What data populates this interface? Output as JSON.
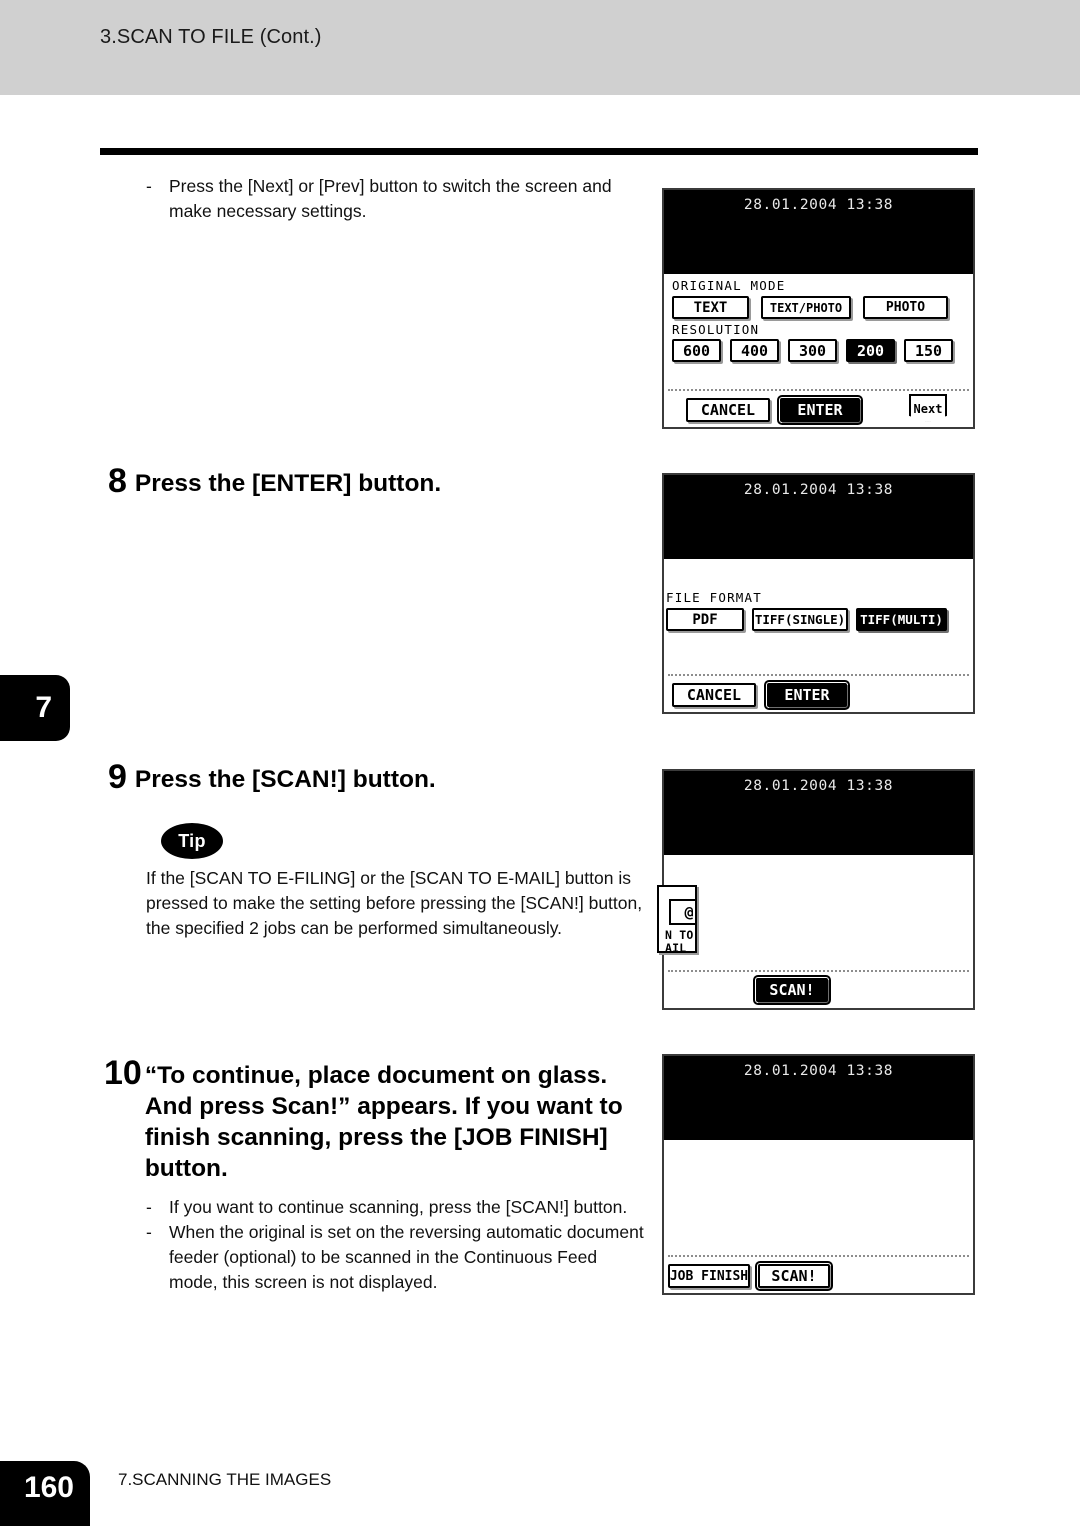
{
  "header": {
    "title": "3.SCAN TO FILE (Cont.)"
  },
  "chapter_tab": {
    "number": "7"
  },
  "footer": {
    "page_number": "160",
    "section": "7.SCANNING THE IMAGES"
  },
  "intro_note": {
    "dash": "-",
    "text": "Press the [Next] or [Prev] button to switch the screen and make necessary settings."
  },
  "steps": [
    {
      "number": "8",
      "title": "Press the [ENTER] button."
    },
    {
      "number": "9",
      "title": "Press the [SCAN!] button."
    },
    {
      "number": "10",
      "title": "“To continue, place document on glass. And press Scan!” appears. If you want to finish scanning, press the [JOB FINISH] button."
    }
  ],
  "tip": {
    "badge": "Tip",
    "text": "If the [SCAN TO E-FILING] or the [SCAN TO E-MAIL] button is pressed to make the setting before pressing the [SCAN!] button, the specified 2 jobs can be performed simultaneously."
  },
  "step10_notes": [
    {
      "dash": "-",
      "text": "If you want to continue scanning, press the [SCAN!] button."
    },
    {
      "dash": "-",
      "text": "When the original is set on the reversing automatic document feeder (optional) to be scanned in the Continuous Feed mode, this screen is not displayed."
    }
  ],
  "screens": [
    {
      "id": "original-mode-resolution",
      "datetime": "28.01.2004 13:38",
      "labels": {
        "original_mode": "ORIGINAL MODE",
        "resolution": "RESOLUTION"
      },
      "original_mode_buttons": [
        {
          "label": "TEXT",
          "selected": true
        },
        {
          "label": "TEXT/PHOTO",
          "selected": false
        },
        {
          "label": "PHOTO",
          "selected": false
        }
      ],
      "resolution_buttons": [
        {
          "label": "600",
          "selected": false
        },
        {
          "label": "400",
          "selected": false
        },
        {
          "label": "300",
          "selected": false
        },
        {
          "label": "200",
          "selected": true
        },
        {
          "label": "150",
          "selected": false
        }
      ],
      "footer_buttons": [
        {
          "label": "CANCEL",
          "selected": false
        },
        {
          "label": "ENTER",
          "selected": true
        }
      ],
      "next_button": "Next"
    },
    {
      "id": "file-format",
      "datetime": "28.01.2004 13:38",
      "labels": {
        "file_format": "FILE FORMAT"
      },
      "file_format_buttons": [
        {
          "label": "PDF",
          "selected": false
        },
        {
          "label": "TIFF(SINGLE)",
          "selected": false
        },
        {
          "label": "TIFF(MULTI)",
          "selected": true
        }
      ],
      "footer_buttons": [
        {
          "label": "CANCEL",
          "selected": false
        },
        {
          "label": "ENTER",
          "selected": true
        }
      ]
    },
    {
      "id": "scan-ready",
      "datetime": "28.01.2004 13:38",
      "email_button": {
        "icon": "@",
        "line1": "N TO",
        "line2": "AIL"
      },
      "footer_buttons": [
        {
          "label": "SCAN!",
          "selected": true
        }
      ]
    },
    {
      "id": "continue-scan",
      "datetime": "28.01.2004 13:38",
      "footer_buttons": [
        {
          "label": "JOB FINISH",
          "selected": false
        },
        {
          "label": "SCAN!",
          "selected": false
        }
      ]
    }
  ]
}
